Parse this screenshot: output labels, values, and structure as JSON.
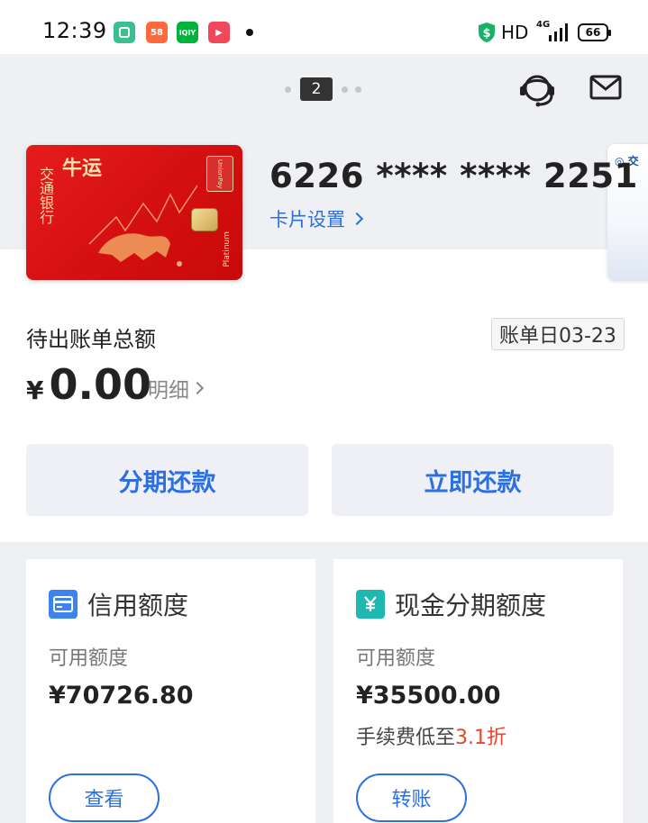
{
  "status_bar": {
    "time": "12:39",
    "apps": [
      {
        "name": "app-icon-1",
        "label": "",
        "color": "#3cbf8f"
      },
      {
        "name": "app-icon-58",
        "label": "58",
        "color": "#ff6a3d"
      },
      {
        "name": "app-icon-iqiyi",
        "label": "iQIY",
        "color": "#00b33c"
      },
      {
        "name": "app-icon-video",
        "label": "▶",
        "color": "#f0485a"
      }
    ],
    "network": "HD",
    "network_gen": "4G",
    "battery": "66"
  },
  "header": {
    "pager_current": "2"
  },
  "card": {
    "number": "6226 **** **** 2251",
    "settings_label": "卡片设置"
  },
  "bill": {
    "label": "待出账单总额",
    "date_label": "账单日03-23",
    "currency": "¥",
    "amount": "0.00",
    "detail_label": "明细"
  },
  "actions": {
    "installment_label": "分期还款",
    "repay_label": "立即还款"
  },
  "credit_limit": {
    "title": "信用额度",
    "sub": "可用额度",
    "value": "¥70726.80",
    "button": "查看"
  },
  "cash_limit": {
    "title": "现金分期额度",
    "sub": "可用额度",
    "value": "¥35500.00",
    "note_prefix": "手续费低至",
    "note_highlight": "3.1折",
    "button": "转账"
  },
  "colors": {
    "accent": "#2c6fe0",
    "highlight": "#e8452c",
    "card_red": "#d40f0f"
  }
}
